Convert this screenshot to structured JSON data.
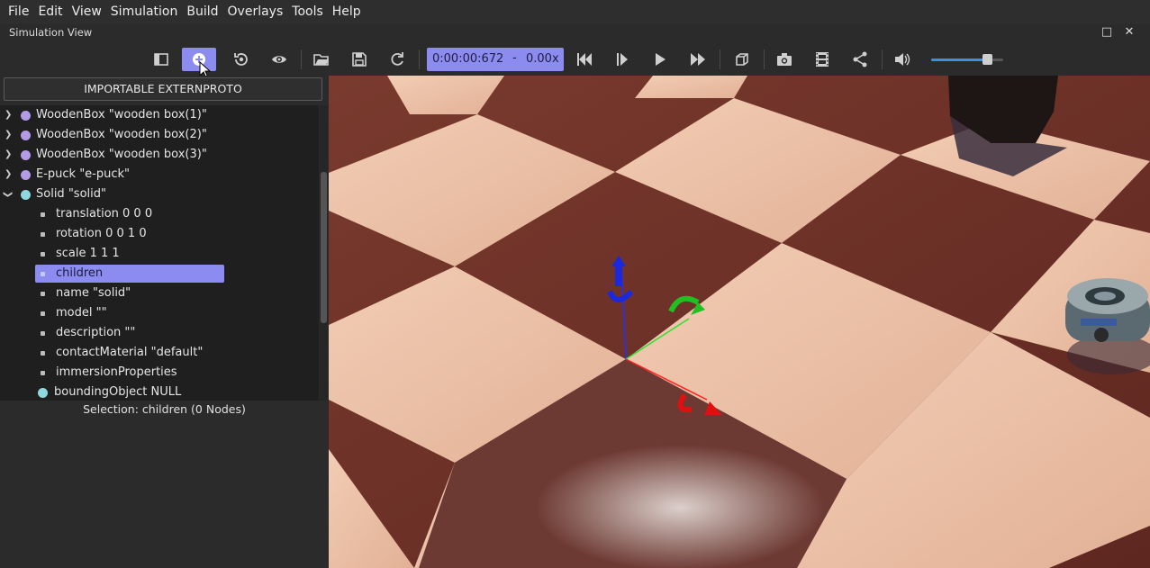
{
  "menu": [
    "File",
    "Edit",
    "View",
    "Simulation",
    "Build",
    "Overlays",
    "Tools",
    "Help"
  ],
  "window": {
    "title": "Simulation View",
    "maximize_icon": "□",
    "close_icon": "✕"
  },
  "toolbar": {
    "time": "0:00:00:672",
    "dash": "-",
    "speed": "0.00x",
    "volume_level": 0.77
  },
  "panel": {
    "extern_button": "IMPORTABLE EXTERNPROTO",
    "tree": [
      {
        "label": "WoodenBox \"wooden box(1)\""
      },
      {
        "label": "WoodenBox \"wooden box(2)\""
      },
      {
        "label": "WoodenBox \"wooden box(3)\""
      },
      {
        "label": "E-puck \"e-puck\""
      },
      {
        "label": "Solid \"solid\""
      },
      {
        "label": "translation 0 0 0"
      },
      {
        "label": "rotation 0 0 1 0"
      },
      {
        "label": "scale 1 1 1"
      },
      {
        "label": "children"
      },
      {
        "label": "name \"solid\""
      },
      {
        "label": "model \"\""
      },
      {
        "label": "description \"\""
      },
      {
        "label": "contactMaterial \"default\""
      },
      {
        "label": "immersionProperties"
      },
      {
        "label": "boundingObject NULL"
      }
    ],
    "selection": "Selection: children (0 Nodes)"
  },
  "colors": {
    "accent": "#8c8cf0",
    "proto_text": "#b0a4f5",
    "panel_bg": "#2b2b2b",
    "tree_bg": "#1f1f1f"
  }
}
